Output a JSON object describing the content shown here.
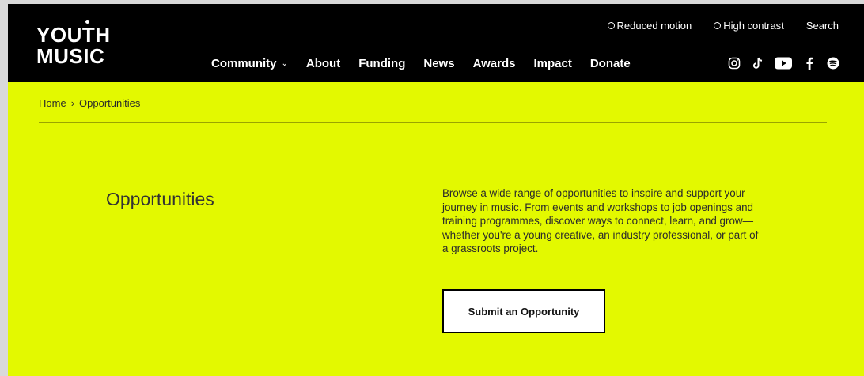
{
  "colors": {
    "brand_lime": "#e3f900",
    "header_bg": "#000000",
    "outer_bg": "#d9d9d9"
  },
  "logo": {
    "line1": "YOUTH",
    "line2": "MUSIC"
  },
  "utility": [
    {
      "label": "Reduced motion",
      "icon": "toggle-ring-icon"
    },
    {
      "label": "High contrast",
      "icon": "toggle-ring-icon"
    },
    {
      "label": "Search"
    }
  ],
  "nav": [
    "Community",
    "About",
    "Funding",
    "News",
    "Awards",
    "Impact",
    "Donate"
  ],
  "social": [
    "instagram-icon",
    "tiktok-icon",
    "youtube-icon",
    "facebook-icon",
    "spotify-icon"
  ],
  "breadcrumb": {
    "home": "Home",
    "separator": "›",
    "current": "Opportunities"
  },
  "page": {
    "title": "Opportunities",
    "intro": "Browse a wide range of opportunities to inspire and support your journey in music. From events and workshops to job openings and training programmes, discover ways to connect, learn, and grow—whether you're a young creative, an industry professional, or part of a grassroots project.",
    "cta": "Submit an Opportunity"
  }
}
